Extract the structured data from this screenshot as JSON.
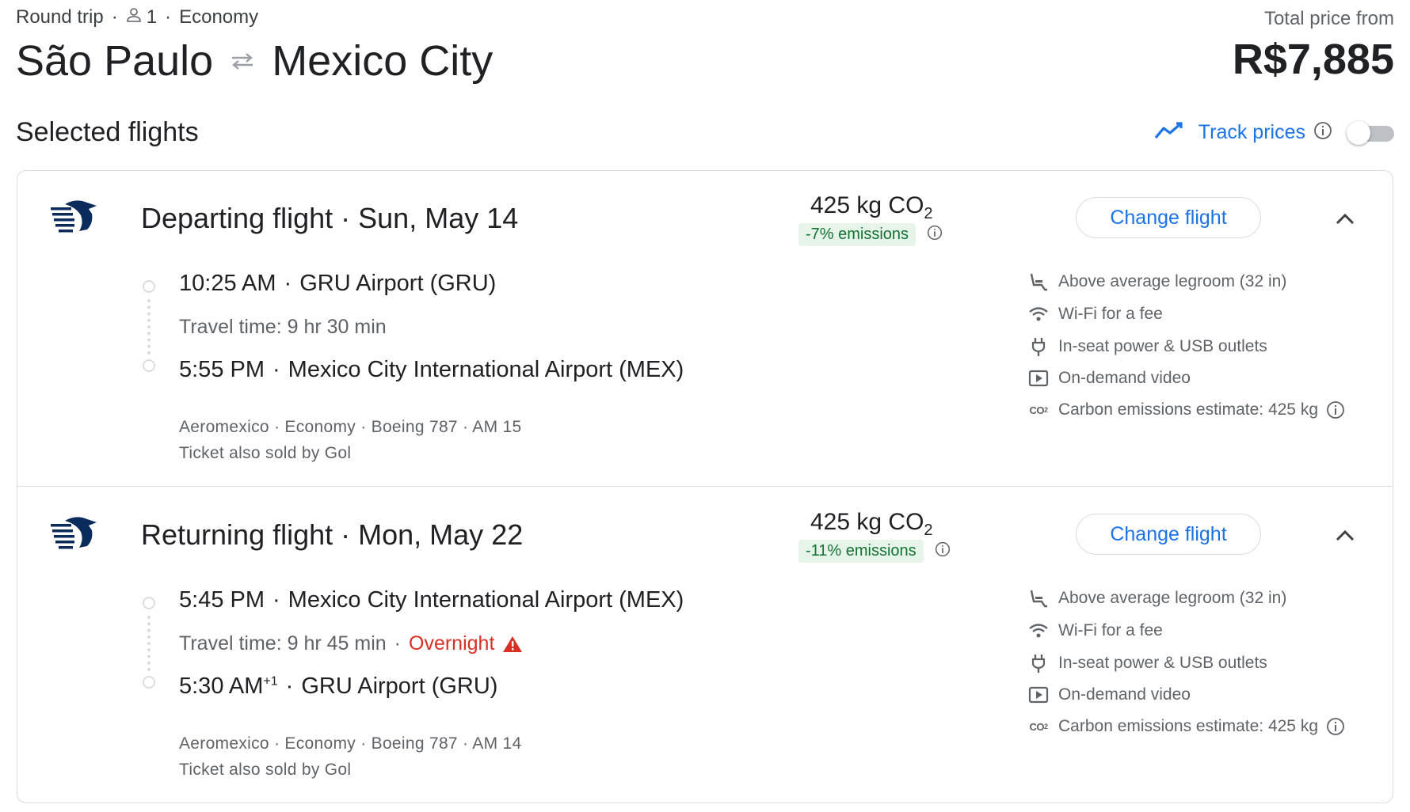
{
  "header": {
    "trip_type": "Round trip",
    "passengers": "1",
    "cabin": "Economy",
    "origin": "São Paulo",
    "destination": "Mexico City",
    "price_label": "Total price from",
    "price": "R$7,885"
  },
  "selected_title": "Selected flights",
  "track": {
    "label": "Track prices",
    "enabled": false
  },
  "departing": {
    "title": "Departing flight",
    "date": "Sun, May 14",
    "co2": "425 kg CO",
    "co2_sub": "2",
    "emissions": "-7% emissions",
    "change_label": "Change flight",
    "dep_time": "10:25 AM",
    "dep_airport": "GRU Airport (GRU)",
    "travel_time": "Travel time: 9 hr 30 min",
    "arr_time": "5:55 PM",
    "arr_sup": "",
    "arr_airport": "Mexico City International Airport (MEX)",
    "details": "Aeromexico · Economy · Boeing 787 · AM 15",
    "sold_by": "Ticket also sold by Gol",
    "amenities": {
      "legroom": "Above average legroom (32 in)",
      "wifi": "Wi-Fi for a fee",
      "power": "In-seat power & USB outlets",
      "video": "On-demand video",
      "carbon": "Carbon emissions estimate: 425 kg"
    }
  },
  "returning": {
    "title": "Returning flight",
    "date": "Mon, May 22",
    "co2": "425 kg CO",
    "co2_sub": "2",
    "emissions": "-11% emissions",
    "change_label": "Change flight",
    "dep_time": "5:45 PM",
    "dep_airport": "Mexico City International Airport (MEX)",
    "travel_time": "Travel time: 9 hr 45 min",
    "overnight": "Overnight",
    "arr_time": "5:30 AM",
    "arr_sup": "+1",
    "arr_airport": "GRU Airport (GRU)",
    "details": "Aeromexico · Economy · Boeing 787 · AM 14",
    "sold_by": "Ticket also sold by Gol",
    "amenities": {
      "legroom": "Above average legroom (32 in)",
      "wifi": "Wi-Fi for a fee",
      "power": "In-seat power & USB outlets",
      "video": "On-demand video",
      "carbon": "Carbon emissions estimate: 425 kg"
    }
  },
  "icons": {
    "person": "person-icon",
    "swap": "swap-arrows-icon",
    "track": "trend-line-icon",
    "info": "info-icon",
    "chevron": "chevron-up-icon",
    "legroom": "seat-legroom-icon",
    "wifi": "wifi-icon",
    "power": "power-plug-icon",
    "video": "video-play-icon",
    "carbon": "co2-icon",
    "warning": "warning-triangle-icon",
    "airline": "aeromexico-logo"
  },
  "colors": {
    "accent": "#1a73e8",
    "text": "#202124",
    "secondary": "#5f6368",
    "emission_bg": "#e6f4ea",
    "emission_fg": "#137333",
    "warning": "#d93025",
    "airline": "#0b2b5c"
  }
}
